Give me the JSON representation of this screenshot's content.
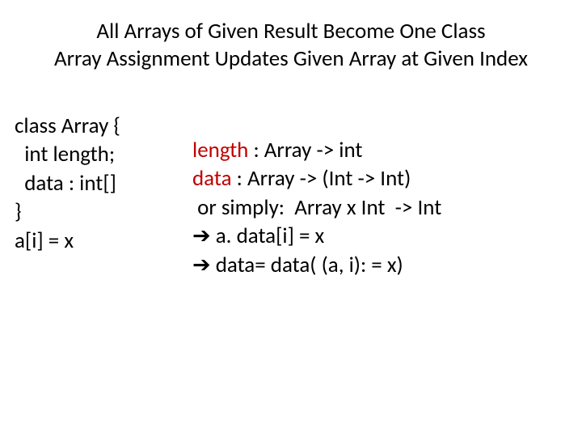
{
  "title": {
    "line1": "All Arrays of Given Result Become One Class",
    "line2": "Array Assignment Updates Given Array at Given Index"
  },
  "left": {
    "l1": "class Array {",
    "l2": "  int length;",
    "l3": "  data : int[]",
    "l4": "}",
    "l5": "a[i] = x"
  },
  "right": {
    "r1a": "length",
    "r1b": " : Array -> int",
    "r2a": "data",
    "r2b": " : Array -> (Int -> Int)",
    "r3": " or simply:  Array x Int  -> Int",
    "r4arrow": "➔",
    "r4": " a. data[i] = x",
    "r5arrow": "➔",
    "r5": " data= data( (a, i): = x)"
  }
}
